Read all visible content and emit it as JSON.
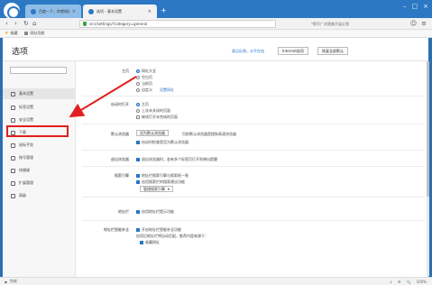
{
  "browser": {
    "tabs": [
      {
        "label": "百度一下，你就知道",
        "close": "×"
      },
      {
        "label": "选项 - 基本设置",
        "close": "×"
      }
    ],
    "new_tab": "+",
    "window_controls": [
      "–",
      "□",
      "×"
    ],
    "nav": {
      "back": "‹",
      "forward": "›",
      "refresh": "↻",
      "home": "⌂"
    },
    "address": "se://settings/?category=general",
    "search_hint": "*俄军广进雅集开展反围",
    "bookmarks": [
      {
        "label": "收藏",
        "icon": "star-icon"
      },
      {
        "label": "网址导航",
        "icon": "page-icon"
      }
    ]
  },
  "settings": {
    "title": "选项",
    "header_link": "意见反馈，水平在加",
    "internet_options": "Internet选项",
    "restore_defaults": "恢复全部默认",
    "search_placeholder": "",
    "sidebar": [
      {
        "label": "基本设置",
        "icon": "home-icon",
        "active": true
      },
      {
        "label": "标签设置",
        "icon": "tab-icon",
        "active": false
      },
      {
        "label": "安全设置",
        "icon": "shield-icon",
        "active": false
      },
      {
        "label": "下载",
        "icon": "download-icon",
        "active": false
      },
      {
        "label": "鼠标手势",
        "icon": "mouse-icon",
        "active": false
      },
      {
        "label": "账号管理",
        "icon": "user-icon",
        "active": false
      },
      {
        "label": "快捷键",
        "icon": "keyboard-icon",
        "active": false
      },
      {
        "label": "扩展管理",
        "icon": "puzzle-icon",
        "active": false
      },
      {
        "label": "高级",
        "icon": "menu-icon",
        "active": false
      }
    ],
    "sections": {
      "homepage": {
        "label": "主页",
        "options": [
          "网址大全",
          "空白页",
          "当前页",
          "自定义"
        ],
        "selected": 0,
        "custom_link": "设置网址"
      },
      "startup": {
        "label": "启动时打开",
        "options": [
          "主页",
          "上次未关闭的页面"
        ],
        "selected": 0,
        "check": "继续打开未完成的页面"
      },
      "default_browser": {
        "label": "默认浏览器",
        "button": "设为默认浏览器",
        "status": "目前默认浏览器是搜狗高速浏览器",
        "check": "启动时检查是否为默认浏览器"
      },
      "close_browser": {
        "label": "退出浏览器",
        "check": "退出浏览器时，若有多个标签页打开则弹出提醒"
      },
      "search_engine": {
        "label": "搜索引擎",
        "checks": [
          "地址栏搜索引擎与搜索框一致",
          "启用搜索栏的搜索建议功能"
        ],
        "dropdown": "管理搜索引擎"
      },
      "address_bar": {
        "label": "地址栏",
        "check": "启用地址栏提示功能"
      },
      "smart_address": {
        "label": "地址栏智能补全",
        "check": "开启地址栏智能补全功能",
        "note": "启用后地址栏将自动匹配，推荐内容来源于：",
        "sub_check": "收藏网址"
      }
    }
  },
  "statusbar": {
    "left": "完成",
    "tools": [
      "↓",
      "⚙",
      "🔍",
      "100%"
    ]
  },
  "colors": {
    "frame": "#2c78c4",
    "accent": "#2a74c8",
    "annotation": "#e02020"
  }
}
